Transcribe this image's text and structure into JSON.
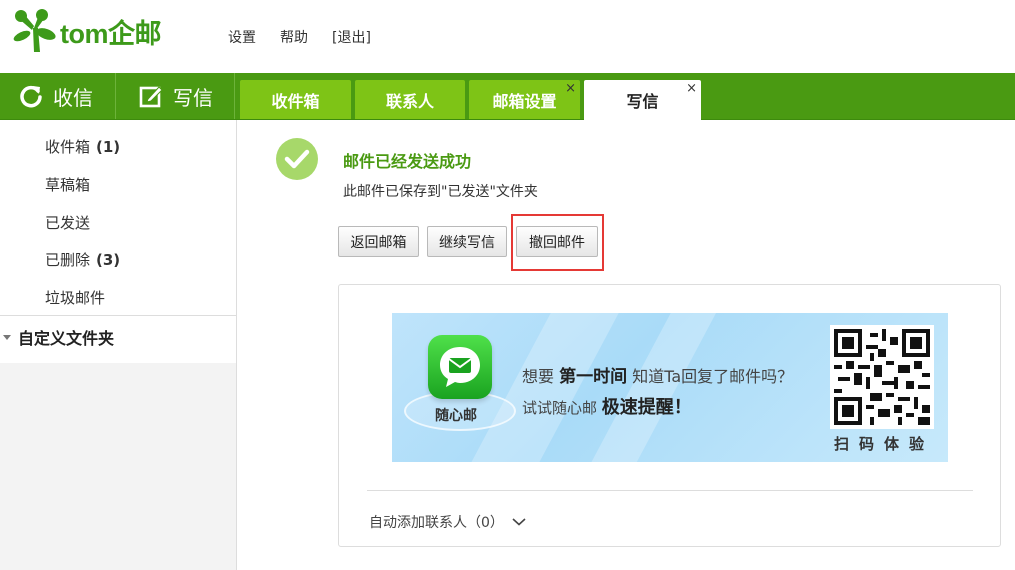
{
  "logo": {
    "text": "tom企邮",
    "color": "#3d9a1a"
  },
  "toplinks": {
    "settings": "设置",
    "help": "帮助",
    "logout": "[退出]"
  },
  "navbar": {
    "receive_label": "收信",
    "compose_label": "写信",
    "color": "#4a9a12",
    "tabs": [
      {
        "label": "收件箱"
      },
      {
        "label": "联系人"
      },
      {
        "label": "邮箱设置",
        "close": "×"
      },
      {
        "label": "写信",
        "close": "×"
      }
    ],
    "tab_color": "#7ec416"
  },
  "sidebar": {
    "folders": [
      {
        "label": "收件箱",
        "count": "(1)"
      },
      {
        "label": "草稿箱"
      },
      {
        "label": "已发送"
      },
      {
        "label": "已删除",
        "count": "(3)"
      },
      {
        "label": "垃圾邮件"
      }
    ],
    "custom_folder": "自定义文件夹"
  },
  "main": {
    "success_title": "邮件已经发送成功",
    "success_sub": "此邮件已保存到\"已发送\"文件夹",
    "buttons": {
      "back": "返回邮箱",
      "continue": "继续写信",
      "recall": "撤回邮件"
    },
    "highlight_color": "#e53935",
    "banner": {
      "app_name": "随心邮",
      "line1_pre": "想要",
      "line1_bold": "第一时间",
      "line1_post": "知道Ta回复了邮件吗？",
      "line2_pre": "试试随心邮",
      "line2_bold": "极速提醒！",
      "qr_caption": "扫码体验"
    },
    "auto_add": "自动添加联系人（0）"
  }
}
